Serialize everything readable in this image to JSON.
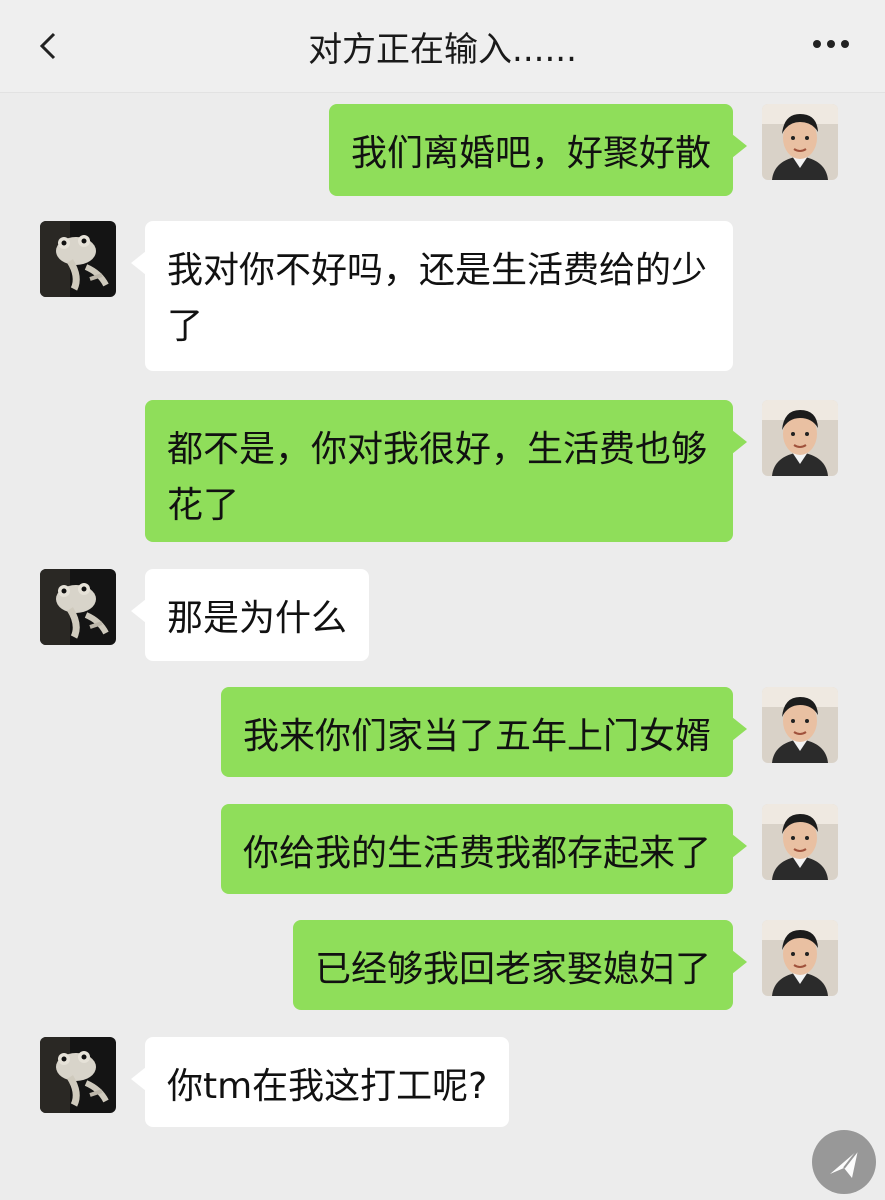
{
  "header": {
    "title": "对方正在输入......",
    "back_icon": "chevron-left-icon",
    "more_icon": "more-dots-icon"
  },
  "messages": [
    {
      "from": "me",
      "text": "我们离婚吧，好聚好散"
    },
    {
      "from": "them",
      "text": "我对你不好吗，还是生活费给的少了"
    },
    {
      "from": "me",
      "text": "都不是，你对我很好，生活费也够花了"
    },
    {
      "from": "them",
      "text": "那是为什么"
    },
    {
      "from": "me",
      "text": "我来你们家当了五年上门女婿"
    },
    {
      "from": "me",
      "text": "你给我的生活费我都存起来了"
    },
    {
      "from": "me",
      "text": "已经够我回老家娶媳妇了"
    },
    {
      "from": "them",
      "text": "你tm在我这打工呢?"
    }
  ],
  "colors": {
    "me_bubble": "#8fde5a",
    "them_bubble": "#ffffff",
    "background": "#ececec"
  }
}
